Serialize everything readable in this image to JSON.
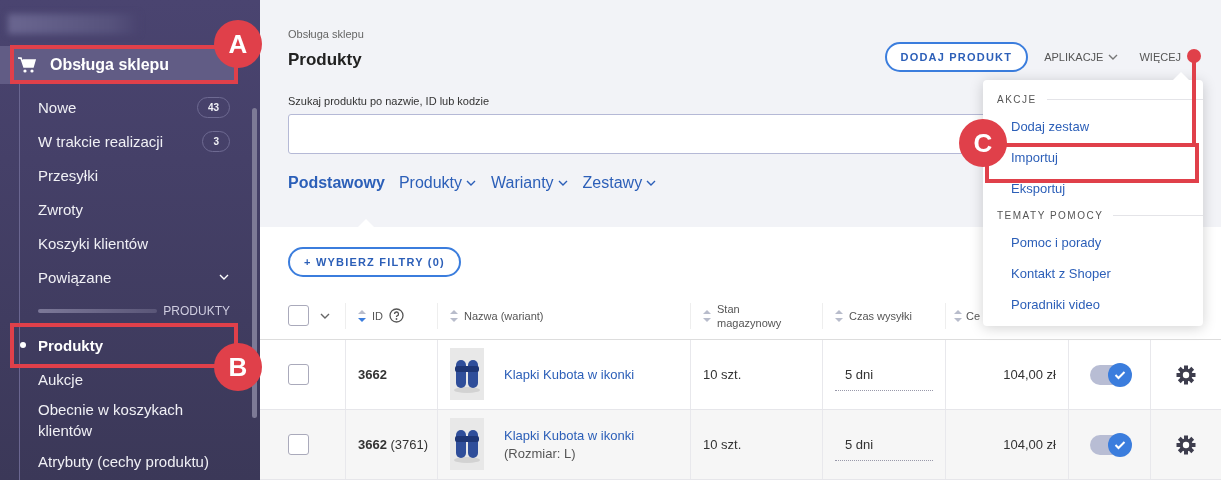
{
  "sidebar": {
    "section": {
      "label": "Obsługa sklepu",
      "selected": true
    },
    "items": [
      {
        "label": "Nowe",
        "count": "43",
        "selected": false
      },
      {
        "label": "W trakcie realizacji",
        "count": "3",
        "selected": false
      },
      {
        "label": "Przesyłki",
        "selected": false
      },
      {
        "label": "Zwroty",
        "selected": false
      },
      {
        "label": "Koszyki klientów",
        "selected": false
      },
      {
        "label": "Powiązane",
        "expandable": true,
        "selected": false
      }
    ],
    "group_label": "PRODUKTY",
    "group_items": [
      {
        "label": "Produkty",
        "selected": true
      },
      {
        "label": "Aukcje",
        "selected": false
      },
      {
        "label": "Obecnie w koszykach klientów",
        "selected": false
      },
      {
        "label": "Atrybuty (cechy produktu)",
        "selected": false
      }
    ]
  },
  "header": {
    "breadcrumb": "Obsługa sklepu",
    "title": "Produkty",
    "add_button": "DODAJ PRODUKT",
    "apps_menu": "APLIKACJE",
    "more_menu": "WIĘCEJ"
  },
  "search": {
    "label": "Szukaj produktu po nazwie, ID lub kodzie"
  },
  "tabs": [
    {
      "label": "Podstawowy",
      "selected": true,
      "dropdown": false
    },
    {
      "label": "Produkty",
      "selected": false,
      "dropdown": true
    },
    {
      "label": "Warianty",
      "selected": false,
      "dropdown": true
    },
    {
      "label": "Zestawy",
      "selected": false,
      "dropdown": true
    }
  ],
  "filter_button": "+ WYBIERZ FILTRY (0)",
  "table": {
    "select_all_checked": false,
    "columns": [
      {
        "label": "ID",
        "sorted": true,
        "help": true
      },
      {
        "label": "Nazwa (wariant)",
        "sorted": false,
        "help": false
      },
      {
        "label": "Stan magazynowy",
        "sorted": false,
        "help": false
      },
      {
        "label": "Czas wysyłki",
        "sorted": false,
        "help": false
      },
      {
        "label": "Ce",
        "sorted": false,
        "help": false
      }
    ],
    "rows": [
      {
        "checked": false,
        "id": "**3662**",
        "name": "Klapki Kubota w ikonki",
        "stock": "10 szt.",
        "shipping": "5 dni",
        "price": "104,00 zł",
        "active": true
      },
      {
        "checked": false,
        "id": "**3662** (3761)",
        "name": "Klapki Kubota w ikonki",
        "variant": "(Rozmiar: L)",
        "stock": "10 szt.",
        "shipping": "5 dni",
        "price": "104,00 zł",
        "active": true
      }
    ]
  },
  "more_dropdown": {
    "sections": [
      {
        "title": "AKCJE",
        "items": [
          "Dodaj zestaw",
          "Importuj",
          "Eksportuj"
        ]
      },
      {
        "title": "TEMATY POMOCY",
        "items": [
          "Pomoc i porady",
          "Kontakt z Shoper",
          "Poradniki video"
        ]
      }
    ]
  },
  "annotations": [
    {
      "label": "A"
    },
    {
      "label": "B"
    },
    {
      "label": "C"
    }
  ]
}
